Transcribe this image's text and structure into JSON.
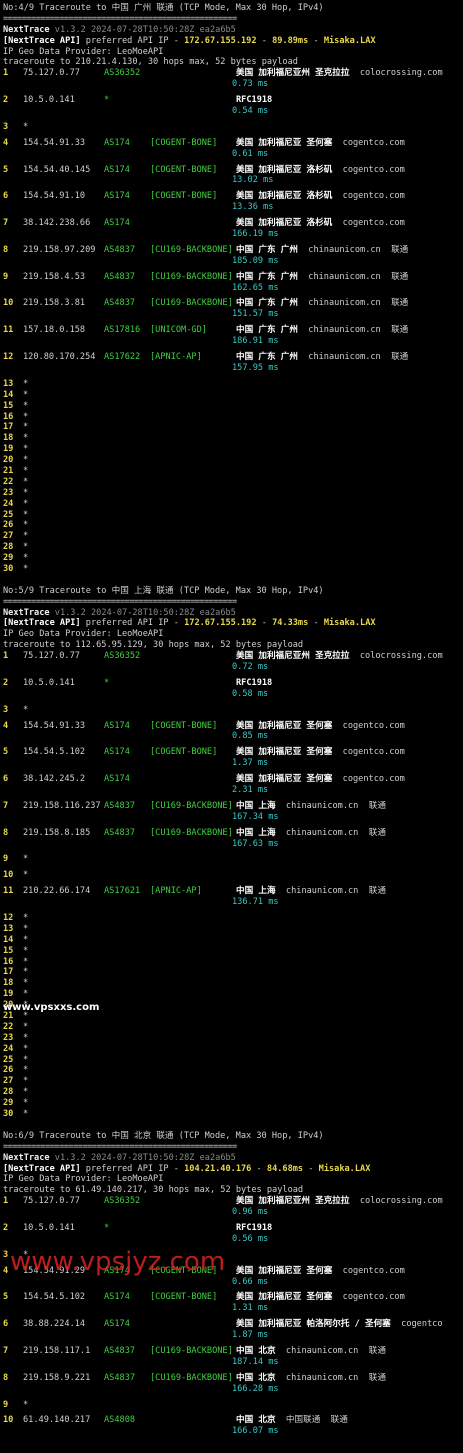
{
  "separator": "==================================================",
  "sections": [
    {
      "header": "No:4/9 Traceroute to 中国 广州 联通 (TCP Mode, Max 30 Hop, IPv4)",
      "nt_name": "NextTrace",
      "nt_meta": "v1.3.2 2024-07-28T10:50:28Z ea2a6b5",
      "api_prefix": "[NextTrace API]",
      "api_mid": " preferred API IP - ",
      "api_ip": "172.67.155.192",
      "api_dash1": " - ",
      "api_ms": "89.89ms",
      "api_dash2": " - ",
      "api_loc": "Misaka.LAX",
      "geo_provider": "IP Geo Data Provider: LeoMoeAPI",
      "traceroute_line": "traceroute to 210.21.4.130, 30 hops max, 52 bytes payload",
      "hops": [
        {
          "n": "1",
          "ip": "75.127.0.77",
          "as": "AS36352",
          "tag": "",
          "geo": "美国 加利福尼亚州 圣克拉拉",
          "domain": "colocrossing.com",
          "isp": "",
          "ms": "0.73 ms"
        },
        {
          "n": "2",
          "ip": "10.5.0.141",
          "as": "*",
          "tag": "",
          "geo": "RFC1918",
          "domain": "",
          "isp": "",
          "ms": "0.54 ms"
        },
        {
          "n": "3",
          "ip": "*",
          "as": "",
          "tag": "",
          "geo": "",
          "domain": "",
          "isp": "",
          "ms": ""
        },
        {
          "n": "4",
          "ip": "154.54.91.33",
          "as": "AS174",
          "tag": "[COGENT-BONE]",
          "geo": "美国 加利福尼亚 圣何塞",
          "domain": "cogentco.com",
          "isp": "",
          "ms": "0.61 ms"
        },
        {
          "n": "5",
          "ip": "154.54.40.145",
          "as": "AS174",
          "tag": "[COGENT-BONE]",
          "geo": "美国 加利福尼亚 洛杉矶",
          "domain": "cogentco.com",
          "isp": "",
          "ms": "13.02 ms"
        },
        {
          "n": "6",
          "ip": "154.54.91.10",
          "as": "AS174",
          "tag": "[COGENT-BONE]",
          "geo": "美国 加利福尼亚 洛杉矶",
          "domain": "cogentco.com",
          "isp": "",
          "ms": "13.36 ms"
        },
        {
          "n": "7",
          "ip": "38.142.238.66",
          "as": "AS174",
          "tag": "",
          "geo": "美国 加利福尼亚 洛杉矶",
          "domain": "cogentco.com",
          "isp": "",
          "ms": "166.19 ms"
        },
        {
          "n": "8",
          "ip": "219.158.97.209",
          "as": "AS4837",
          "tag": "[CU169-BACKBONE]",
          "geo": "中国 广东 广州",
          "domain": "chinaunicom.cn",
          "isp": "联通",
          "ms": "185.09 ms"
        },
        {
          "n": "9",
          "ip": "219.158.4.53",
          "as": "AS4837",
          "tag": "[CU169-BACKBONE]",
          "geo": "中国 广东 广州",
          "domain": "chinaunicom.cn",
          "isp": "联通",
          "ms": "162.65 ms"
        },
        {
          "n": "10",
          "ip": "219.158.3.81",
          "as": "AS4837",
          "tag": "[CU169-BACKBONE]",
          "geo": "中国 广东 广州",
          "domain": "chinaunicom.cn",
          "isp": "联通",
          "ms": "151.57 ms"
        },
        {
          "n": "11",
          "ip": "157.18.0.158",
          "as": "AS17816",
          "tag": "[UNICOM-GD]",
          "geo": "中国 广东 广州",
          "domain": "chinaunicom.cn",
          "isp": "联通",
          "ms": "186.91 ms"
        },
        {
          "n": "12",
          "ip": "120.80.170.254",
          "as": "AS17622",
          "tag": "[APNIC-AP]",
          "geo": "中国 广东 广州",
          "domain": "chinaunicom.cn",
          "isp": "联通",
          "ms": "157.95 ms"
        }
      ],
      "stars_from": 13
    },
    {
      "header": "No:5/9 Traceroute to 中国 上海 联通 (TCP Mode, Max 30 Hop, IPv4)",
      "nt_name": "NextTrace",
      "nt_meta": "v1.3.2 2024-07-28T10:50:28Z ea2a6b5",
      "api_prefix": "[NextTrace API]",
      "api_mid": " preferred API IP - ",
      "api_ip": "172.67.155.192",
      "api_dash1": " - ",
      "api_ms": "74.33ms",
      "api_dash2": " - ",
      "api_loc": "Misaka.LAX",
      "geo_provider": "IP Geo Data Provider: LeoMoeAPI",
      "traceroute_line": "traceroute to 112.65.95.129, 30 hops max, 52 bytes payload",
      "hops": [
        {
          "n": "1",
          "ip": "75.127.0.77",
          "as": "AS36352",
          "tag": "",
          "geo": "美国 加利福尼亚州 圣克拉拉",
          "domain": "colocrossing.com",
          "isp": "",
          "ms": "0.72 ms"
        },
        {
          "n": "2",
          "ip": "10.5.0.141",
          "as": "*",
          "tag": "",
          "geo": "RFC1918",
          "domain": "",
          "isp": "",
          "ms": "0.58 ms"
        },
        {
          "n": "3",
          "ip": "*",
          "as": "",
          "tag": "",
          "geo": "",
          "domain": "",
          "isp": "",
          "ms": ""
        },
        {
          "n": "4",
          "ip": "154.54.91.33",
          "as": "AS174",
          "tag": "[COGENT-BONE]",
          "geo": "美国 加利福尼亚 圣何塞",
          "domain": "cogentco.com",
          "isp": "",
          "ms": "0.85 ms"
        },
        {
          "n": "5",
          "ip": "154.54.5.102",
          "as": "AS174",
          "tag": "[COGENT-BONE]",
          "geo": "美国 加利福尼亚 圣何塞",
          "domain": "cogentco.com",
          "isp": "",
          "ms": "1.37 ms"
        },
        {
          "n": "6",
          "ip": "38.142.245.2",
          "as": "AS174",
          "tag": "",
          "geo": "美国 加利福尼亚 圣何塞",
          "domain": "cogentco.com",
          "isp": "",
          "ms": "2.31 ms"
        },
        {
          "n": "7",
          "ip": "219.158.116.237",
          "as": "AS4837",
          "tag": "[CU169-BACKBONE]",
          "geo": "中国 上海",
          "domain": "chinaunicom.cn",
          "isp": "联通",
          "ms": "167.34 ms"
        },
        {
          "n": "8",
          "ip": "219.158.8.185",
          "as": "AS4837",
          "tag": "[CU169-BACKBONE]",
          "geo": "中国 上海",
          "domain": "chinaunicom.cn",
          "isp": "联通",
          "ms": "167.63 ms"
        },
        {
          "n": "9",
          "ip": "*",
          "as": "",
          "tag": "",
          "geo": "",
          "domain": "",
          "isp": "",
          "ms": ""
        },
        {
          "n": "10",
          "ip": "*",
          "as": "",
          "tag": "",
          "geo": "",
          "domain": "",
          "isp": "",
          "ms": ""
        },
        {
          "n": "11",
          "ip": "210.22.66.174",
          "as": "AS17621",
          "tag": "[APNIC-AP]",
          "geo": "中国 上海",
          "domain": "chinaunicom.cn",
          "isp": "联通",
          "ms": "136.71 ms"
        }
      ],
      "stars_from": 12
    },
    {
      "header": "No:6/9 Traceroute to 中国 北京 联通 (TCP Mode, Max 30 Hop, IPv4)",
      "nt_name": "NextTrace",
      "nt_meta": "v1.3.2 2024-07-28T10:50:28Z ea2a6b5",
      "api_prefix": "[NextTrace API]",
      "api_mid": " preferred API IP - ",
      "api_ip": "104.21.40.176",
      "api_dash1": " - ",
      "api_ms": "84.68ms",
      "api_dash2": " - ",
      "api_loc": "Misaka.LAX",
      "geo_provider": "IP Geo Data Provider: LeoMoeAPI",
      "traceroute_line": "traceroute to 61.49.140.217, 30 hops max, 52 bytes payload",
      "hops": [
        {
          "n": "1",
          "ip": "75.127.0.77",
          "as": "AS36352",
          "tag": "",
          "geo": "美国 加利福尼亚州 圣克拉拉",
          "domain": "colocrossing.com",
          "isp": "",
          "ms": "0.96 ms"
        },
        {
          "n": "2",
          "ip": "10.5.0.141",
          "as": "*",
          "tag": "",
          "geo": "RFC1918",
          "domain": "",
          "isp": "",
          "ms": "0.56 ms"
        },
        {
          "n": "3",
          "ip": "*",
          "as": "",
          "tag": "",
          "geo": "",
          "domain": "",
          "isp": "",
          "ms": ""
        },
        {
          "n": "4",
          "ip": "154.54.91.29",
          "as": "AS174",
          "tag": "[COGENT-BONE]",
          "geo": "美国 加利福尼亚 圣何塞",
          "domain": "cogentco.com",
          "isp": "",
          "ms": "0.66 ms"
        },
        {
          "n": "5",
          "ip": "154.54.5.102",
          "as": "AS174",
          "tag": "[COGENT-BONE]",
          "geo": "美国 加利福尼亚 圣何塞",
          "domain": "cogentco.com",
          "isp": "",
          "ms": "1.31 ms"
        },
        {
          "n": "6",
          "ip": "38.88.224.14",
          "as": "AS174",
          "tag": "",
          "geo": "美国 加利福尼亚 帕洛阿尔托 / 圣何塞",
          "domain": "cogentco",
          "isp": "",
          "ms": "1.87 ms"
        },
        {
          "n": "7",
          "ip": "219.158.117.1",
          "as": "AS4837",
          "tag": "[CU169-BACKBONE]",
          "geo": "中国 北京",
          "domain": "chinaunicom.cn",
          "isp": "联通",
          "ms": "187.14 ms"
        },
        {
          "n": "8",
          "ip": "219.158.9.221",
          "as": "AS4837",
          "tag": "[CU169-BACKBONE]",
          "geo": "中国 北京",
          "domain": "chinaunicom.cn",
          "isp": "联通",
          "ms": "166.28 ms"
        },
        {
          "n": "9",
          "ip": "*",
          "as": "",
          "tag": "",
          "geo": "",
          "domain": "",
          "isp": "",
          "ms": ""
        },
        {
          "n": "10",
          "ip": "61.49.140.217",
          "as": "AS4808",
          "tag": "",
          "geo": "中国 北京",
          "domain": "中国联通",
          "isp": "联通",
          "ms": "166.07 ms"
        }
      ],
      "stars_from": 31
    }
  ],
  "watermark_top": "www.vpsxxs.com",
  "watermark_bottom": "www.vpsjyz.com"
}
